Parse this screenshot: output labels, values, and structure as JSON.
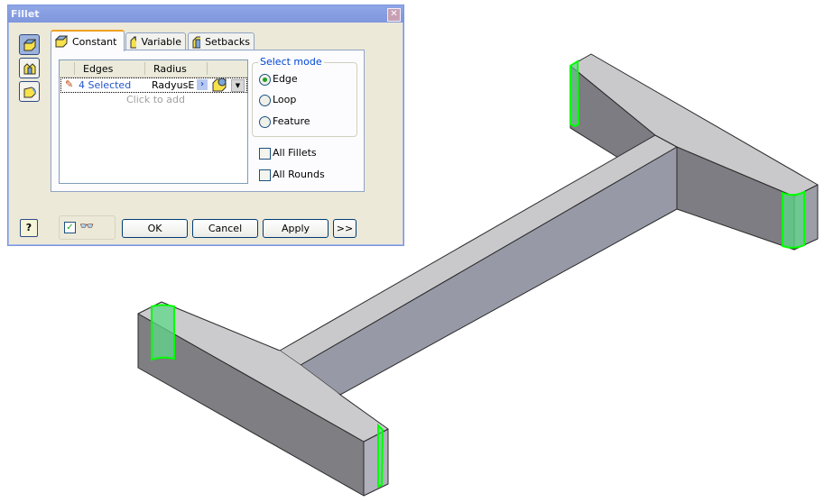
{
  "dialog": {
    "title": "Fillet",
    "close_icon": "close-icon",
    "mode_buttons": [
      {
        "icon": "edge-fillet-icon",
        "active": true
      },
      {
        "icon": "face-fillet-icon",
        "active": false
      },
      {
        "icon": "full-round-fillet-icon",
        "active": false
      }
    ],
    "tabs": [
      {
        "label": "Constant",
        "icon": "constant-fillet-icon",
        "active": true
      },
      {
        "label": "Variable",
        "icon": "variable-fillet-icon",
        "active": false
      },
      {
        "label": "Setbacks",
        "icon": "setbacks-icon",
        "active": false
      }
    ],
    "table": {
      "columns": [
        "Edges",
        "Radius"
      ],
      "rows": [
        {
          "edges": "4 Selected",
          "radius": "RadyusE"
        }
      ],
      "placeholder": "Click to add"
    },
    "select_mode": {
      "label": "Select mode",
      "options": [
        "Edge",
        "Loop",
        "Feature"
      ],
      "selected": "Edge"
    },
    "checkboxes": [
      {
        "label": "All Fillets",
        "checked": false
      },
      {
        "label": "All Rounds",
        "checked": false
      }
    ],
    "preview_checked": true,
    "buttons": {
      "ok": "OK",
      "cancel": "Cancel",
      "apply": "Apply",
      "more": ">>"
    },
    "help_icon": "help-icon"
  },
  "model": {
    "description": "I-shaped extruded part",
    "selected_edges": 4,
    "highlight_color": "#00ff00",
    "face_top": "#cbcbce",
    "face_front": "#7f7e83",
    "face_side": "#b2b3bf"
  }
}
